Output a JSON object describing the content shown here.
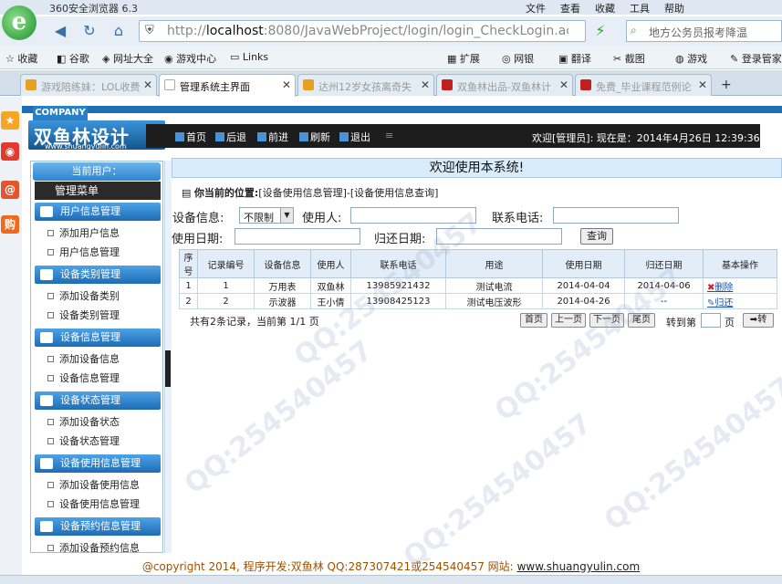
{
  "browser": {
    "title": "360安全浏览器 6.3",
    "menus": [
      "文件",
      "查看",
      "收藏",
      "工具",
      "帮助"
    ],
    "url_host": "localhost",
    "url_rest": ":8080/JavaWebProject/login/login_CheckLogin.acti",
    "search_text": "地方公务员报考降温",
    "favorites": [
      "收藏",
      "谷歌",
      "网址大全",
      "游戏中心",
      "Links"
    ],
    "extras": [
      "扩展",
      "网银",
      "翻译",
      "截图",
      "游戏",
      "登录管家"
    ],
    "tabs": [
      {
        "label": "游戏陪练妹：LOL收费",
        "active": false
      },
      {
        "label": "管理系统主界面",
        "active": true
      },
      {
        "label": "达州12岁女孩离奇失",
        "active": false
      },
      {
        "label": "双鱼林出品-双鱼林计",
        "active": false
      },
      {
        "label": "免费_毕业课程范例论",
        "active": false
      }
    ]
  },
  "app": {
    "company_tag": "COMPANY",
    "brand": "双鱼林设计",
    "brand_url": "www.shuangyulin.com",
    "toolbar": {
      "home": "首页",
      "back": "后退",
      "forward": "前进",
      "refresh": "刷新",
      "logout": "退出"
    },
    "welcome": "欢迎[管理员]:   现在是：2014年4月26日  12:39:36"
  },
  "sidebar": {
    "current_user_label": "当前用户：",
    "main_menu": "管理菜单",
    "groups": [
      {
        "title": "用户信息管理",
        "items": [
          "添加用户信息",
          "用户信息管理"
        ]
      },
      {
        "title": "设备类别管理",
        "items": [
          "添加设备类别",
          "设备类别管理"
        ]
      },
      {
        "title": "设备信息管理",
        "items": [
          "添加设备信息",
          "设备信息管理"
        ]
      },
      {
        "title": "设备状态管理",
        "items": [
          "添加设备状态",
          "设备状态管理"
        ]
      },
      {
        "title": "设备使用信息管理",
        "items": [
          "添加设备使用信息",
          "设备使用信息管理"
        ]
      },
      {
        "title": "设备预约信息管理",
        "items": [
          "添加设备预约信息"
        ]
      }
    ]
  },
  "main": {
    "banner": "欢迎使用本系统!",
    "crumb_prefix": "你当前的位置:",
    "crumb_path": "[设备使用信息管理]-[设备使用信息查询]",
    "filters": {
      "device_label": "设备信息:",
      "device_value": "不限制",
      "user_label": "使用人:",
      "phone_label": "联系电话:",
      "use_date_label": "使用日期:",
      "return_date_label": "归还日期:",
      "query_button": "查询"
    },
    "table": {
      "headers": [
        "序号",
        "记录编号",
        "设备信息",
        "使用人",
        "联系电话",
        "用途",
        "使用日期",
        "归还日期",
        "基本操作"
      ],
      "rows": [
        [
          "1",
          "1",
          "万用表",
          "双鱼林",
          "13985921432",
          "测试电流",
          "2014-04-04",
          "2014-04-06",
          "删除"
        ],
        [
          "2",
          "2",
          "示波器",
          "王小倩",
          "13908425123",
          "测试电压波形",
          "2014-04-26",
          "--",
          "归还"
        ]
      ]
    },
    "pager": {
      "summary": "共有2条记录，当前第 1/1 页",
      "first": "首页",
      "prev": "上一页",
      "next": "下一页",
      "last": "尾页",
      "goto_label": "转到第",
      "page_unit": "页",
      "go": "转"
    }
  },
  "footer": {
    "copyright": "@copyright 2014, 程序开发:双鱼林  QQ:287307421或254540457  网站:",
    "site": "www.shuangyulin.com"
  },
  "watermark": "QQ:254540457"
}
